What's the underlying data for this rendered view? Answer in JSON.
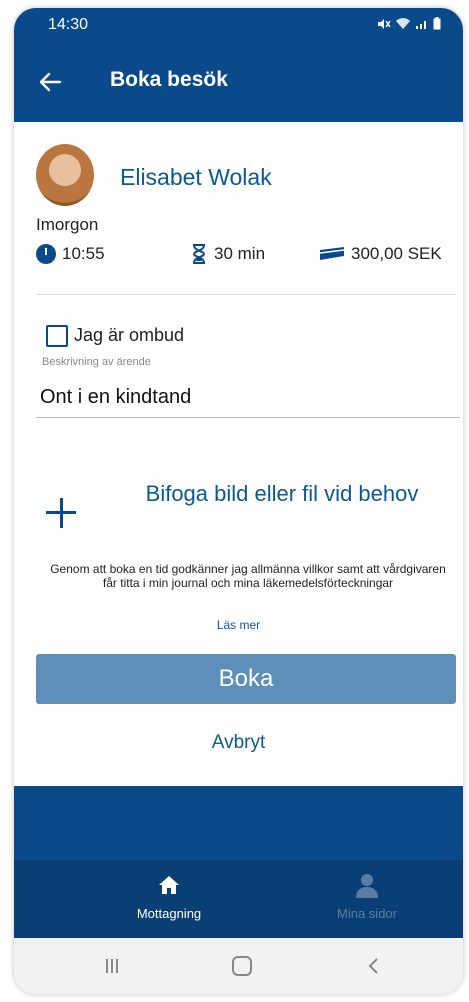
{
  "status_bar": {
    "time": "14:30"
  },
  "app_bar": {
    "title": "Boka besök",
    "back_icon": "arrow-left-icon"
  },
  "doctor": {
    "name": "Elisabet Wolak"
  },
  "appointment": {
    "day": "Imorgon",
    "time": "10:55",
    "duration": "30 min",
    "price": "300,00 SEK"
  },
  "form": {
    "agent_checkbox_label": "Jag är ombud",
    "agent_checked": false,
    "description_label": "Beskrivning av ärende",
    "description_value": "Ont i en kindtand"
  },
  "attach": {
    "label": "Bifoga bild eller fil vid behov"
  },
  "terms": {
    "text": "Genom att boka en tid godkänner jag allmänna villkor samt att vårdgivaren får titta i min journal och mina läkemedelsförteckningar",
    "read_more": "Läs mer"
  },
  "actions": {
    "book": "Boka",
    "cancel": "Avbryt"
  },
  "bottom_nav": {
    "items": [
      {
        "label": "Mottagning",
        "icon": "home-icon",
        "active": true
      },
      {
        "label": "Mina sidor",
        "icon": "person-icon",
        "active": false
      }
    ]
  },
  "colors": {
    "primary": "#0b4a8a",
    "button": "#5d8fb8",
    "link": "#0b5a8e"
  }
}
